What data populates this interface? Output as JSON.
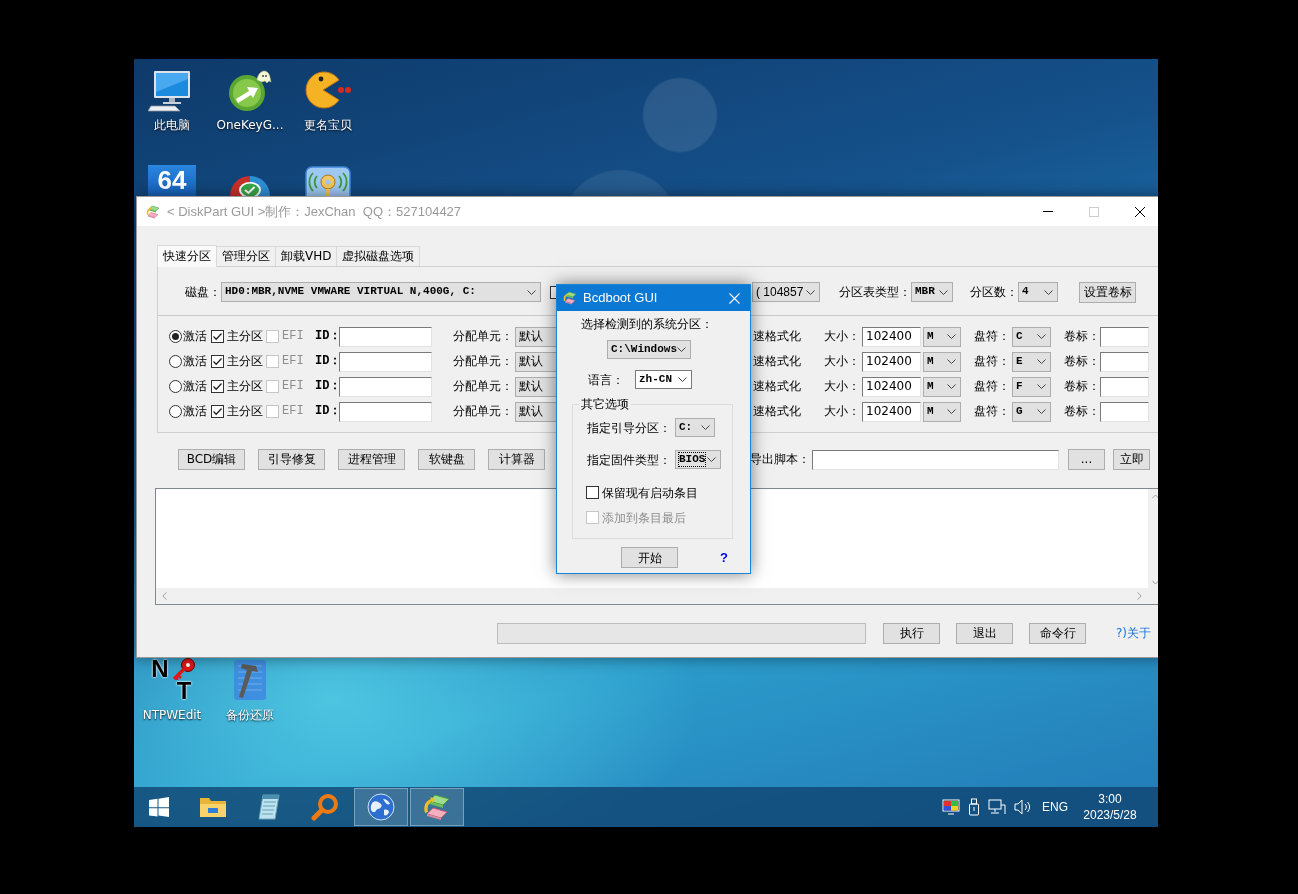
{
  "desktop_icons": [
    {
      "kind": "monitor",
      "label": "此电脑"
    },
    {
      "kind": "disc-arrow",
      "label": "OneKeyG..."
    },
    {
      "kind": "pacman",
      "label": "更名宝贝"
    },
    {
      "kind": "number-tile",
      "text": "64"
    },
    {
      "kind": "disk-check"
    },
    {
      "kind": "key-signal"
    },
    {
      "kind": "key-letters",
      "letters": [
        "N",
        "T"
      ],
      "label": "NTPWEdit"
    },
    {
      "kind": "hammer",
      "label": "备份还原"
    }
  ],
  "main_window": {
    "active": false,
    "title": "< DiskPart GUI >制作：JexChan  QQ：527104427",
    "maximize_disabled": true,
    "tabs": [
      {
        "label": "快速分区",
        "selected": true
      },
      {
        "label": "管理分区",
        "selected": false
      },
      {
        "label": "卸载VHD",
        "selected": false
      },
      {
        "label": "虚拟磁盘选项",
        "selected": false
      }
    ],
    "disk_row": {
      "label": "磁盘：",
      "disk": "HD0:MBR,NVME VMWARE VIRTUAL N,400G, C:",
      "checked": false,
      "size": "( 104857",
      "table_type_label": "分区表类型：",
      "table_type": "MBR",
      "count_label": "分区数：",
      "count": "4",
      "set_label_button": "设置卷标"
    },
    "partitions": [
      {
        "active": true,
        "active_label": "激活",
        "primary": true,
        "primary_label": "主分区",
        "efi": false,
        "efi_disabled": true,
        "efi_label": "EFI",
        "id_label": "ID：",
        "alloc_label": "分配单元：",
        "alloc": "默认",
        "format_label": "速格式化",
        "size_label": "大小：",
        "size": "102400",
        "unit": "M",
        "letter_label": "盘符：",
        "letter": "C",
        "volume_label": "卷标："
      },
      {
        "active": false,
        "active_label": "激活",
        "primary": true,
        "primary_label": "主分区",
        "efi": false,
        "efi_disabled": true,
        "efi_label": "EFI",
        "id_label": "ID：",
        "alloc_label": "分配单元：",
        "alloc": "默认",
        "format_label": "速格式化",
        "size_label": "大小：",
        "size": "102400",
        "unit": "M",
        "letter_label": "盘符：",
        "letter": "E",
        "volume_label": "卷标："
      },
      {
        "active": false,
        "active_label": "激活",
        "primary": true,
        "primary_label": "主分区",
        "efi": false,
        "efi_disabled": true,
        "efi_label": "EFI",
        "id_label": "ID：",
        "alloc_label": "分配单元：",
        "alloc": "默认",
        "format_label": "速格式化",
        "size_label": "大小：",
        "size": "102400",
        "unit": "M",
        "letter_label": "盘符：",
        "letter": "F",
        "volume_label": "卷标："
      },
      {
        "active": false,
        "active_label": "激活",
        "primary": true,
        "primary_label": "主分区",
        "efi": false,
        "efi_disabled": true,
        "efi_label": "EFI",
        "id_label": "ID：",
        "alloc_label": "分配单元：",
        "alloc": "默认",
        "format_label": "速格式化",
        "size_label": "大小：",
        "size": "102400",
        "unit": "M",
        "letter_label": "盘符：",
        "letter": "G",
        "volume_label": "卷标："
      }
    ],
    "tool_buttons": [
      "BCD编辑",
      "引导修复",
      "进程管理",
      "软键盘",
      "计算器"
    ],
    "export": {
      "label": "导出脚本：",
      "browse_button": "...",
      "run_button": "立即"
    },
    "bottom_bar": {
      "progress": {
        "level": 0
      },
      "buttons": [
        "执行",
        "退出",
        "命令行"
      ],
      "about_link": "?)关于"
    }
  },
  "dialog": {
    "active": true,
    "title": "Bcdboot GUI",
    "system_label": "选择检测到的系统分区：",
    "system": "C:\\Windows",
    "language_label": "语言：",
    "language": "zh-CN",
    "group_title": "其它选项",
    "boot_label": "指定引导分区：",
    "boot": "C:",
    "firmware_label": "指定固件类型：",
    "firmware": "BIOS",
    "firmware_focused": true,
    "options": [
      {
        "label": "保留现有启动条目",
        "checked": false,
        "disabled": false
      },
      {
        "label": "添加到条目最后",
        "checked": false,
        "disabled": true
      }
    ],
    "start_button": "开始",
    "help_link": "?"
  },
  "taskbar": {
    "items": [
      {
        "kind": "start",
        "running": false
      },
      {
        "kind": "folder",
        "running": false
      },
      {
        "kind": "notepad",
        "running": false
      },
      {
        "kind": "search",
        "running": false
      },
      {
        "kind": "globe",
        "running": true
      },
      {
        "kind": "diskpart",
        "running": true
      }
    ],
    "tray": {
      "icons": [
        {
          "kind": "display"
        },
        {
          "kind": "usb"
        },
        {
          "kind": "network"
        },
        {
          "kind": "volume"
        }
      ],
      "language": "ENG",
      "time": "3:00",
      "date": "2023/5/28"
    }
  }
}
